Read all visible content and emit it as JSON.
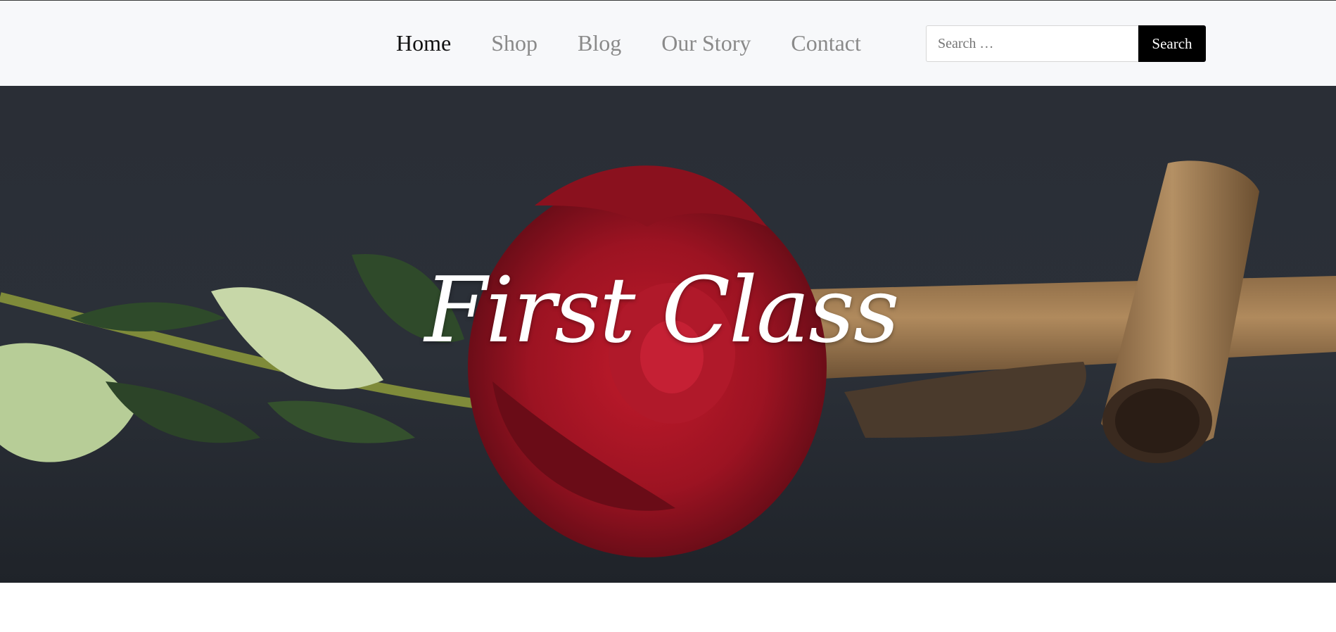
{
  "nav": {
    "items": [
      {
        "label": "Home",
        "active": true
      },
      {
        "label": "Shop",
        "active": false
      },
      {
        "label": "Blog",
        "active": false
      },
      {
        "label": "Our Story",
        "active": false
      },
      {
        "label": "Contact",
        "active": false
      }
    ]
  },
  "search": {
    "placeholder": "Search …",
    "button_label": "Search"
  },
  "hero": {
    "title": "First Class"
  },
  "colors": {
    "header_bg": "#f7f8fa",
    "nav_active": "#111111",
    "nav_inactive": "#8a8a8a",
    "search_button_bg": "#000000",
    "hero_bg": "#262a31",
    "rose": "#9e1420",
    "cigar": "#a67f52"
  }
}
